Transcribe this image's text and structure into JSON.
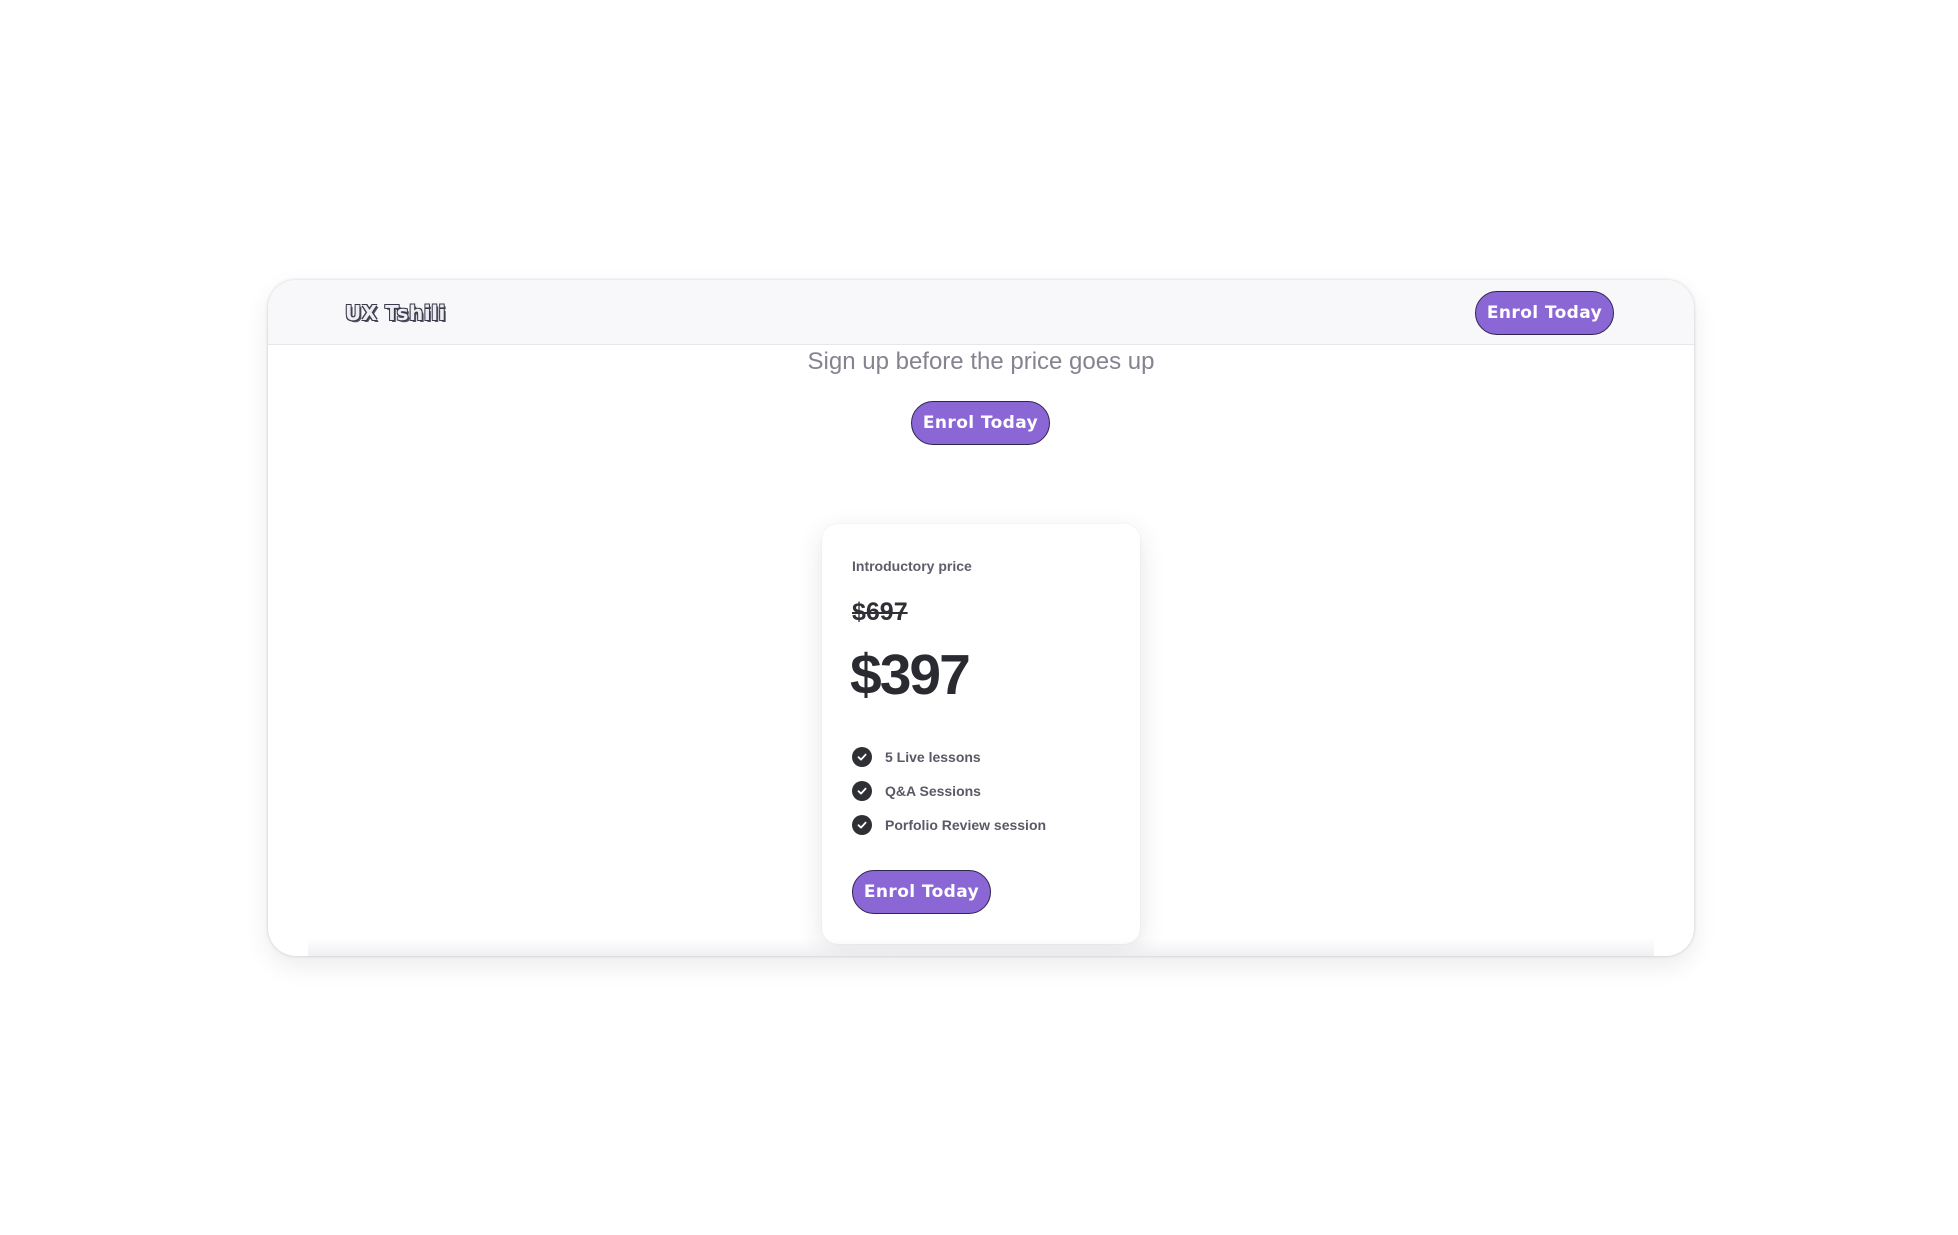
{
  "navbar": {
    "logo_text": "UX Tshili",
    "cta_label": "Enrol Today"
  },
  "hero": {
    "subtitle": "Sign up before the price goes up",
    "cta_label": "Enrol Today"
  },
  "pricing_card": {
    "tagline": "Introductory price",
    "original_price": "$697",
    "current_price": "$397",
    "features": [
      {
        "label": "5 Live lessons",
        "icon": "check-circle-icon"
      },
      {
        "label": "Q&A Sessions",
        "icon": "check-circle-icon"
      },
      {
        "label": "Porfolio Review session",
        "icon": "check-circle-icon"
      }
    ],
    "cta_label": "Enrol Today"
  },
  "colors": {
    "accent": "#8b67d6",
    "button_border": "#2e2450",
    "text_dark": "#2a2a31",
    "text_muted": "#848490"
  }
}
